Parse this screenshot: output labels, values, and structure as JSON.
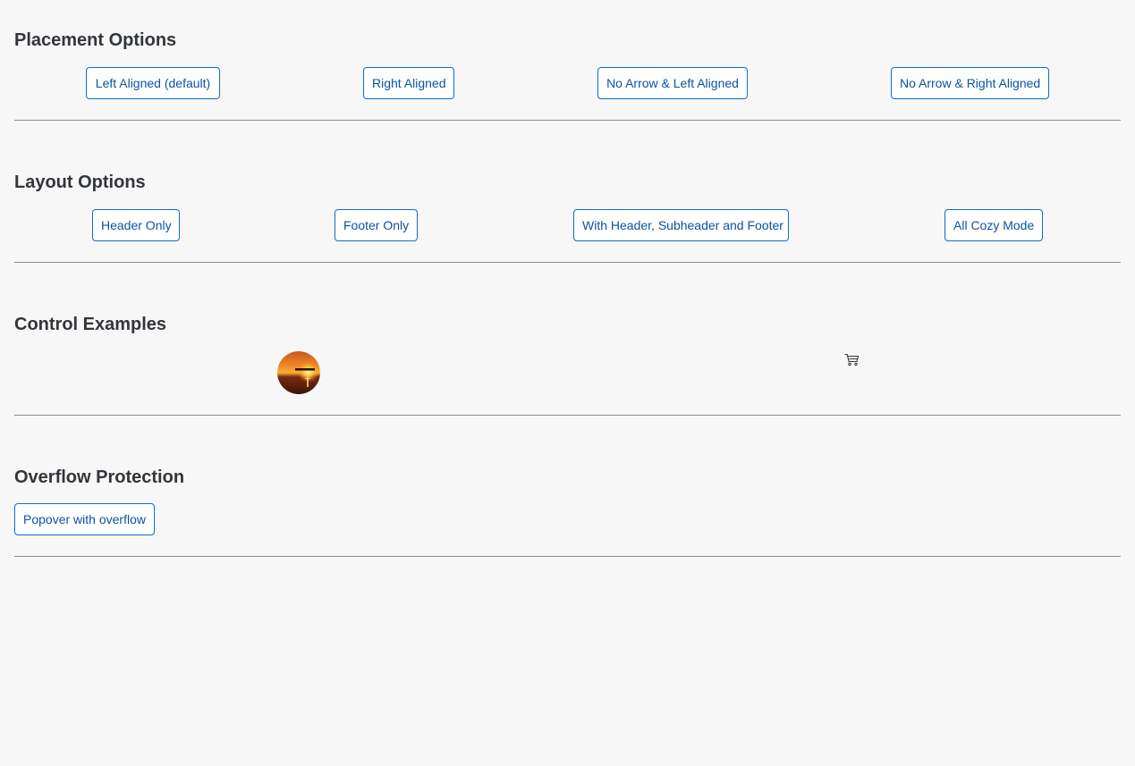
{
  "sections": {
    "placement": {
      "title": "Placement Options",
      "buttons": [
        "Left Aligned (default)",
        "Right Aligned",
        "No Arrow & Left Aligned",
        "No Arrow & Right Aligned"
      ]
    },
    "layout": {
      "title": "Layout Options",
      "buttons": [
        "Header Only",
        "Footer Only",
        "With Header, Subheader and Footer",
        "All Cozy Mode"
      ]
    },
    "controls": {
      "title": "Control Examples",
      "avatar_icon": "avatar-image",
      "cart_icon": "cart-icon"
    },
    "overflow": {
      "title": "Overflow Protection",
      "buttons": [
        "Popover with overflow"
      ]
    }
  },
  "colors": {
    "background": "#f7f7f7",
    "button_border": "#0a6ed1",
    "button_text": "#0854a0",
    "title_text": "#32363a",
    "divider": "#8c8c8c"
  }
}
